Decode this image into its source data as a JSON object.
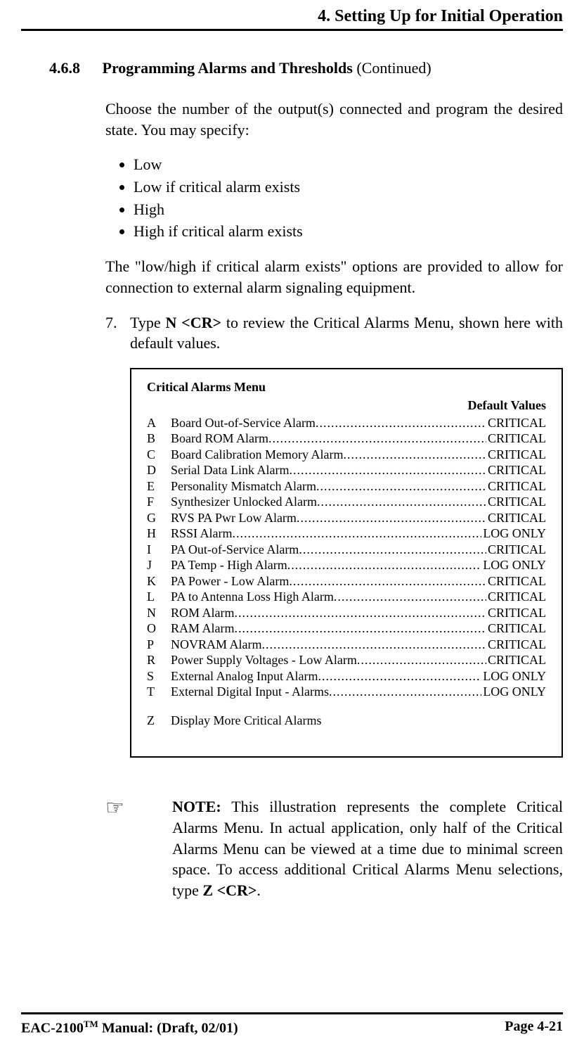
{
  "header": {
    "chapter": "4. Setting Up for Initial Operation"
  },
  "section": {
    "number": "4.6.8",
    "title": "Programming Alarms and Thresholds",
    "continued": " (Continued)"
  },
  "intro": "Choose the number of the output(s) connected and program the desired state. You may specify:",
  "bullets": [
    "Low",
    "Low if critical alarm exists",
    "High",
    "High if critical alarm exists"
  ],
  "para2": "The \"low/high if critical alarm exists\" options are provided to allow for connection to external alarm signaling equipment.",
  "step": {
    "num": "7.",
    "pre": "Type ",
    "cmd": "N <CR>",
    "post": " to review the Critical Alarms Menu, shown here with default values."
  },
  "menu": {
    "title": "Critical Alarms Menu",
    "default_header": "Default Values",
    "rows": [
      {
        "k": "A",
        "l": "Board Out-of-Service Alarm",
        "v": "CRITICAL"
      },
      {
        "k": "B",
        "l": "Board ROM Alarm",
        "v": "CRITICAL"
      },
      {
        "k": "C",
        "l": "Board Calibration Memory Alarm",
        "v": "CRITICAL"
      },
      {
        "k": "D",
        "l": "Serial Data Link Alarm",
        "v": "CRITICAL"
      },
      {
        "k": "E",
        "l": "Personality Mismatch Alarm",
        "v": "CRITICAL"
      },
      {
        "k": "F",
        "l": "Synthesizer Unlocked Alarm",
        "v": "CRITICAL"
      },
      {
        "k": "G",
        "l": "RVS PA Pwr Low Alarm",
        "v": "CRITICAL"
      },
      {
        "k": "H",
        "l": "RSSI Alarm",
        "v": "LOG ONLY"
      },
      {
        "k": "I",
        "l": "PA Out-of-Service Alarm",
        "v": "CRITICAL"
      },
      {
        "k": "J",
        "l": "PA Temp - High Alarm",
        "v": "LOG ONLY"
      },
      {
        "k": "K",
        "l": "PA Power - Low Alarm",
        "v": "CRITICAL"
      },
      {
        "k": "L",
        "l": "PA to Antenna Loss High Alarm",
        "v": "CRITICAL"
      },
      {
        "k": "N",
        "l": "ROM Alarm",
        "v": "CRITICAL"
      },
      {
        "k": "O",
        "l": "RAM Alarm",
        "v": "CRITICAL"
      },
      {
        "k": "P",
        "l": "NOVRAM Alarm",
        "v": "CRITICAL"
      },
      {
        "k": "R",
        "l": "Power Supply Voltages - Low Alarm",
        "v": "CRITICAL"
      },
      {
        "k": "S",
        "l": "External Analog Input Alarm",
        "v": "LOG ONLY"
      },
      {
        "k": "T",
        "l": "External Digital Input - Alarms",
        "v": "LOG ONLY"
      }
    ],
    "z_key": "Z",
    "z_label": "Display More Critical Alarms"
  },
  "note": {
    "icon": "☞",
    "label": "NOTE:",
    "text_pre": " This illustration represents the complete Critical Alarms Menu. In actual application, only half of the Critical Alarms Menu can be viewed at a time due to minimal screen space. To access additional Critical Alarms Menu selections, type ",
    "cmd": "Z <CR>",
    "text_post": "."
  },
  "footer": {
    "left_pre": "EAC-2100",
    "left_tm": "TM",
    "left_post": " Manual: (Draft, 02/01)",
    "right": "Page 4-21"
  }
}
